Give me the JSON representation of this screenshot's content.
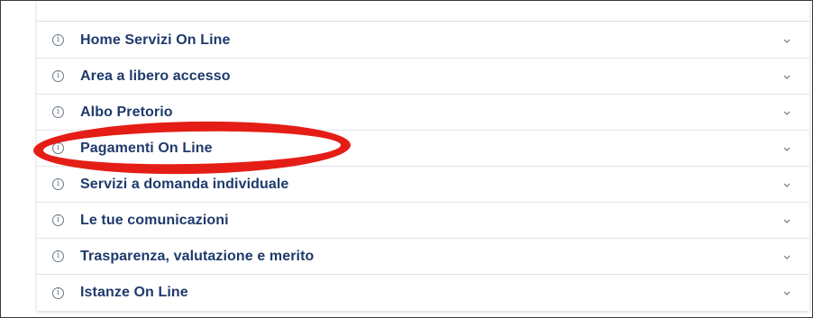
{
  "accordion": {
    "items": [
      {
        "label": "Home Servizi On Line"
      },
      {
        "label": "Area a libero accesso"
      },
      {
        "label": "Albo Pretorio"
      },
      {
        "label": "Pagamenti On Line"
      },
      {
        "label": "Servizi a domanda individuale"
      },
      {
        "label": "Le tue comunicazioni"
      },
      {
        "label": "Trasparenza, valutazione e merito"
      },
      {
        "label": "Istanze On Line"
      }
    ],
    "info_icon": "info-circle-icon",
    "expand_icon": "chevron-down-icon"
  },
  "annotation": {
    "shape": "red-ellipse-highlight",
    "color": "#e41e16",
    "highlighted_item": "Pagamenti On Line"
  },
  "colors": {
    "label": "#1e3a6b",
    "icon": "#6b7785",
    "divider": "#e1e4e8",
    "highlight": "#e41e16"
  }
}
